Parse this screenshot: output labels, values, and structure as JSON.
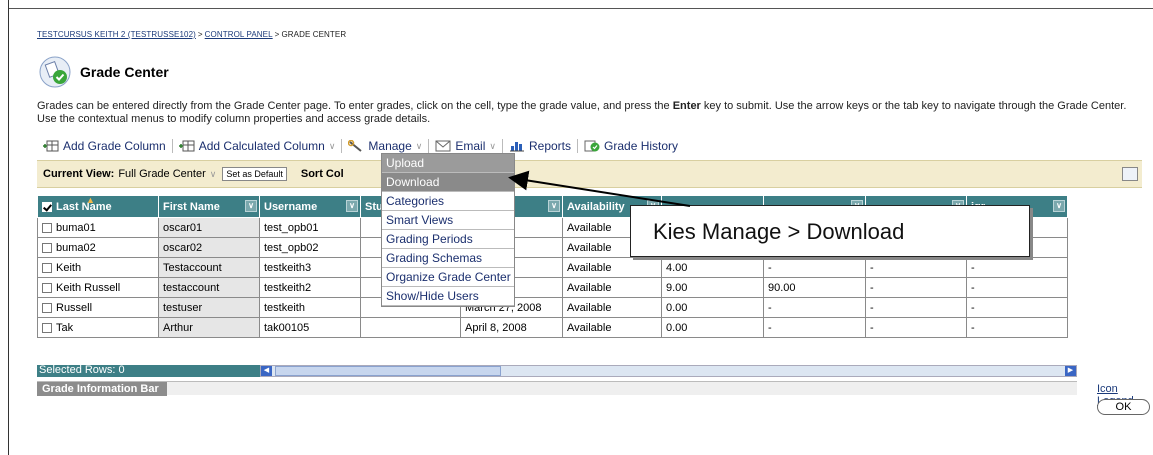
{
  "breadcrumb": {
    "course": "TESTCURSUS KEITH 2 (TESTRUSSE102)",
    "separator1": ">",
    "control_panel": "CONTROL PANEL",
    "separator2": ">",
    "current": "GRADE CENTER"
  },
  "page_title": "Grade Center",
  "instructions": {
    "part1": "Grades can be entered directly from the Grade Center page. To enter grades, click on the cell, type the grade value, and press the ",
    "enter": "Enter",
    "part2": " key to submit. Use the arrow keys or the tab key to navigate through the Grade Center. Use the contextual menus to modify column properties and access grade details."
  },
  "toolbar": {
    "add_grade_column": "Add Grade Column",
    "add_calculated_column": "Add Calculated Column",
    "manage": "Manage",
    "email": "Email",
    "reports": "Reports",
    "grade_history": "Grade History"
  },
  "viewbar": {
    "current_view_label": "Current View:",
    "current_view_value": "Full Grade Center",
    "set_as_default": "Set as Default",
    "sort_label": "Sort Col"
  },
  "table": {
    "headers": {
      "last_name": "Last Name",
      "first_name": "First Name",
      "username": "Username",
      "student_id": "Stu",
      "last_access": "s",
      "availability": "Availability",
      "total": "",
      "weighted": "",
      "col9": "",
      "col10": "igr"
    },
    "rows": [
      {
        "last": "buma01",
        "first": "oscar01",
        "user": "test_opb01",
        "sid": "",
        "access": "2008",
        "avail": "Available",
        "total": "",
        "weighted": "",
        "c9": "",
        "c10": ""
      },
      {
        "last": "buma02",
        "first": "oscar02",
        "user": "test_opb02",
        "sid": "",
        "access": "2008",
        "avail": "Available",
        "total": "",
        "weighted": "",
        "c9": "",
        "c10": ""
      },
      {
        "last": "Keith",
        "first": "Testaccount",
        "user": "testkeith3",
        "sid": "",
        "access": "",
        "avail": "Available",
        "total": "4.00",
        "weighted": "-",
        "c9": "-",
        "c10": "-"
      },
      {
        "last": "Keith Russell",
        "first": "testaccount",
        "user": "testkeith2",
        "sid": "",
        "access": "08",
        "avail": "Available",
        "total": "9.00",
        "weighted": "90.00",
        "c9": "-",
        "c10": "-"
      },
      {
        "last": "Russell",
        "first": "testuser",
        "user": "testkeith",
        "sid": "",
        "access": "March 27, 2008",
        "avail": "Available",
        "total": "0.00",
        "weighted": "-",
        "c9": "-",
        "c10": "-"
      },
      {
        "last": "Tak",
        "first": "Arthur",
        "user": "tak00105",
        "sid": "",
        "access": "April 8, 2008",
        "avail": "Available",
        "total": "0.00",
        "weighted": "-",
        "c9": "-",
        "c10": "-"
      }
    ]
  },
  "selected_rows": "Selected Rows: 0",
  "info_bar_label": "Grade Information Bar",
  "icon_legend": "Icon Legend",
  "ok_label": "OK",
  "manage_menu": [
    "Upload",
    "Download",
    "Categories",
    "Smart Views",
    "Grading Periods",
    "Grading Schemas",
    "Organize Grade Center",
    "Show/Hide Users"
  ],
  "callout": "Kies Manage > Download",
  "colors": {
    "header_teal": "#3d7f86",
    "viewbar_bg": "#f3eccf",
    "link_blue": "#1b3a7a"
  }
}
